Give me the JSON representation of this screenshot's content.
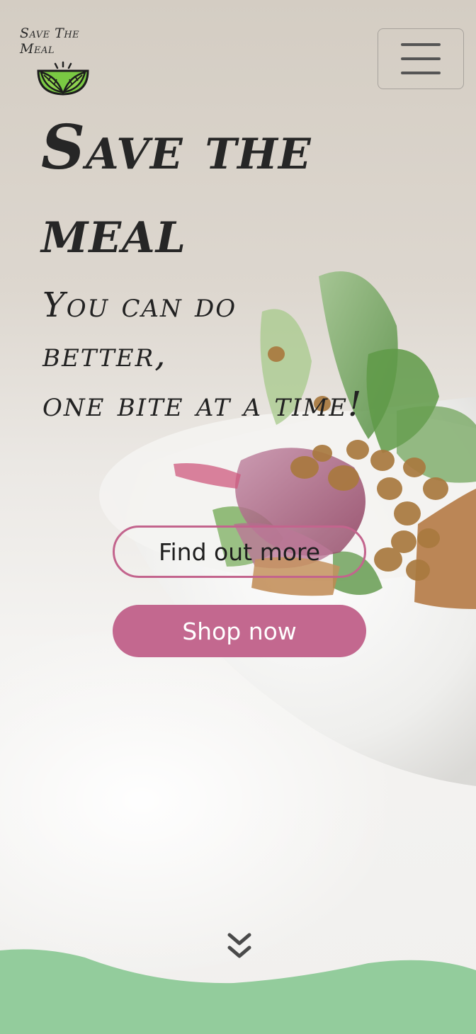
{
  "logo": {
    "text": "Save The Meal",
    "icon": "leaf-bowl-icon"
  },
  "nav": {
    "menu_icon": "hamburger-menu-icon"
  },
  "hero": {
    "title": "Save the meal",
    "subtitle": "You can do better,\none bite at a time!",
    "find_out_more_label": "Find out more",
    "shop_now_label": "Shop now",
    "scroll_icon": "double-chevron-down-icon"
  },
  "colors": {
    "accent_pink": "#c3688f",
    "wave_green": "#93cc9c",
    "leaf_green": "#7ac943",
    "text_dark": "#262626"
  }
}
